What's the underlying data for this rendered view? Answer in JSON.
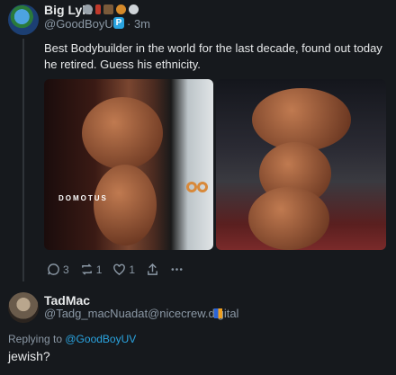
{
  "post": {
    "author": "Big Lyle",
    "handle": "@GoodBoyUV",
    "time": "· 3m",
    "text": "Best Bodybuilder in the world for the last decade, found out today he retired. Guess his ethnicity.",
    "image1_watermark": "DOMOTUS",
    "actions": {
      "replies": "3",
      "reposts": "1",
      "likes": "1"
    }
  },
  "reply": {
    "author": "TadMac",
    "handle": "@Tadg_macNuadat@nicecrew.digital",
    "replying_prefix": "Replying to ",
    "replying_to": "@GoodBoyUV",
    "text": "jewish?"
  },
  "colors": {
    "background": "#16191d",
    "accent": "#2aa4e0",
    "muted": "#8b98a5"
  }
}
